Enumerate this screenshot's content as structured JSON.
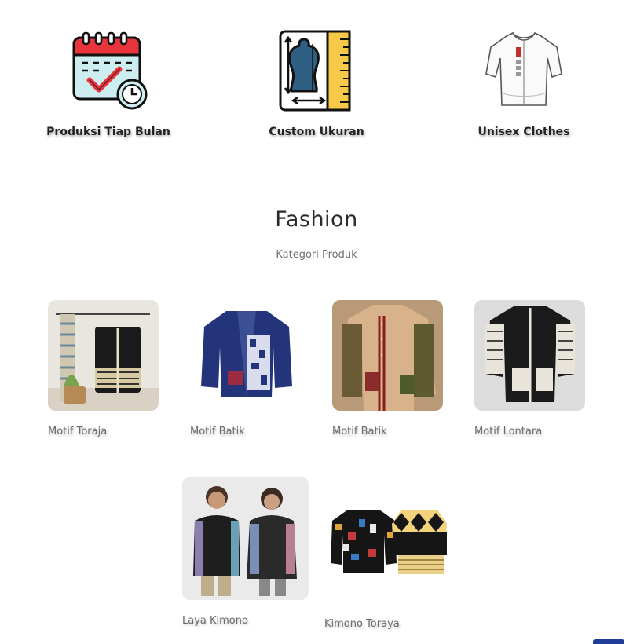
{
  "features": [
    {
      "label": "Produksi Tiap Bulan",
      "icon": "calendar-check-icon"
    },
    {
      "label": "Custom Ukuran",
      "icon": "tailor-mannequin-ruler-icon"
    },
    {
      "label": "Unisex Clothes",
      "icon": "white-shirt-icon"
    }
  ],
  "section": {
    "title": "Fashion",
    "subtitle": "Kategori Produk"
  },
  "products": [
    {
      "name": "Motif Toraja"
    },
    {
      "name": "Motif Batik"
    },
    {
      "name": "Motif Batik"
    },
    {
      "name": "Motif Lontara"
    },
    {
      "name": "Laya Kimono"
    },
    {
      "name": "Kimono Toraya"
    }
  ],
  "colors": {
    "calendar_red": "#e8343d",
    "calendar_check": "#e8343d",
    "mannequin_blue": "#2f5f82",
    "ruler_yellow": "#f7c948",
    "scroll_button": "#1f3e9a"
  }
}
